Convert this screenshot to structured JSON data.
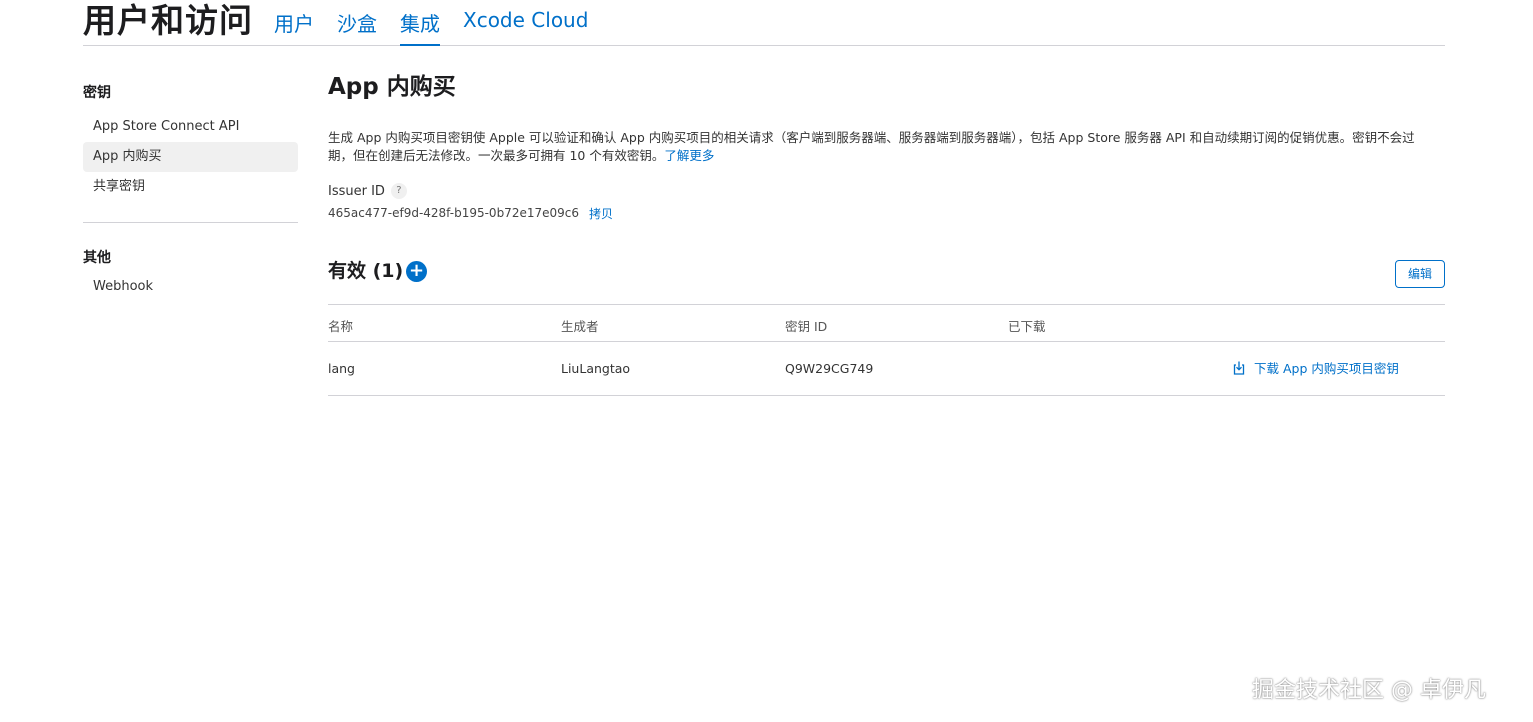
{
  "header": {
    "title": "用户和访问",
    "tabs": [
      {
        "label": "用户"
      },
      {
        "label": "沙盒"
      },
      {
        "label": "集成"
      },
      {
        "label": "Xcode Cloud"
      }
    ],
    "active_tab": "集成"
  },
  "sidebar": {
    "sections": [
      {
        "title": "密钥",
        "items": [
          "App Store Connect API",
          "App 内购买",
          "共享密钥"
        ]
      },
      {
        "title": "其他",
        "items": [
          "Webhook"
        ]
      }
    ],
    "selected_item": "App 内购买"
  },
  "main": {
    "title": "App 内购买",
    "description": "生成 App 内购买项目密钥使 Apple 可以验证和确认 App 内购买项目的相关请求（客户端到服务器端、服务器端到服务器端），包括 App Store 服务器 API 和自动续期订阅的促销优惠。密钥不会过期，但在创建后无法修改。一次最多可拥有 10 个有效密钥。",
    "learn_more": "了解更多",
    "issuer_label": "Issuer ID",
    "issuer_help": "?",
    "issuer_id": "465ac477-ef9d-428f-b195-0b72e17e09c6",
    "copy_label": "拷贝",
    "active_title": "有效 (1)",
    "add_symbol": "+",
    "edit_label": "编辑",
    "table": {
      "columns": [
        "名称",
        "生成者",
        "密钥 ID",
        "已下载"
      ],
      "rows": [
        {
          "name": "lang",
          "creator": "LiuLangtao",
          "key_id": "Q9W29CG749",
          "downloaded": "",
          "action": "下载 App 内购买项目密钥"
        }
      ]
    }
  },
  "watermark": "掘金技术社区 @ 卓伊凡",
  "colors": {
    "accent": "#0070c9",
    "divider": "#d2d2d7",
    "selected_bg": "#f0f0f0"
  },
  "icons": {
    "add": "plus-circle-icon",
    "help": "question-icon",
    "download": "download-icon"
  }
}
